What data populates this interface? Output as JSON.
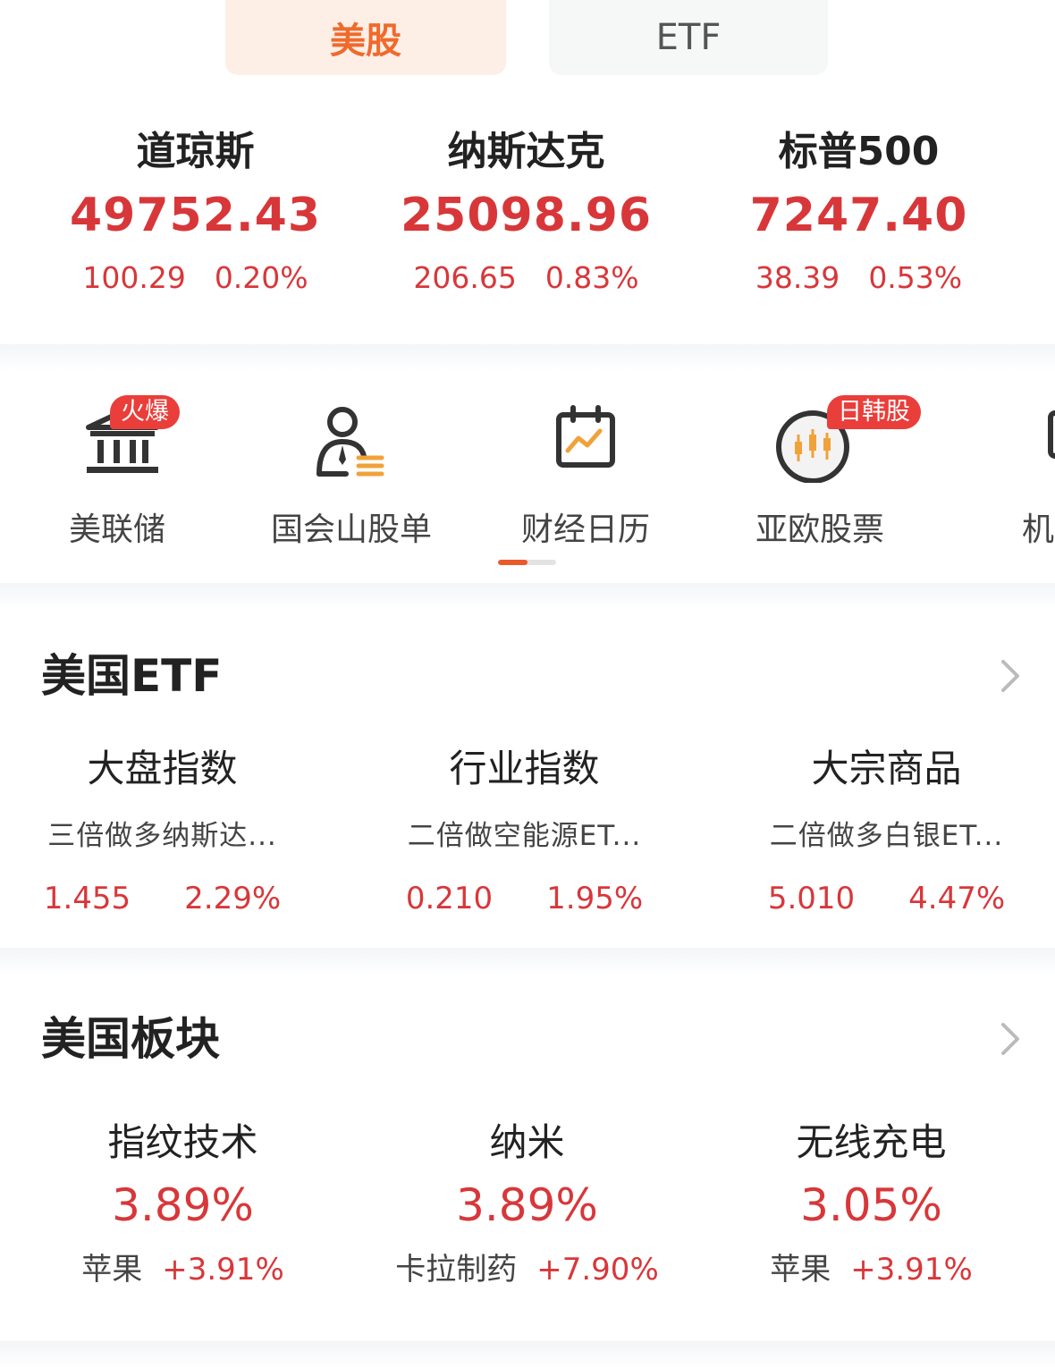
{
  "tabs": [
    {
      "label": "美股",
      "active": true
    },
    {
      "label": "ETF",
      "active": false
    }
  ],
  "indices": [
    {
      "name": "道琼斯",
      "price": "49752.43",
      "change": "100.29",
      "pct": "0.20%"
    },
    {
      "name": "纳斯达克",
      "price": "25098.96",
      "change": "206.65",
      "pct": "0.83%"
    },
    {
      "name": "标普500",
      "price": "7247.40",
      "change": "38.39",
      "pct": "0.53%"
    }
  ],
  "shortcuts": [
    {
      "label": "美联储",
      "icon": "bank-icon",
      "badge": "火爆"
    },
    {
      "label": "国会山股单",
      "icon": "congress-person-icon",
      "badge": ""
    },
    {
      "label": "财经日历",
      "icon": "calendar-chart-icon",
      "badge": ""
    },
    {
      "label": "亚欧股票",
      "icon": "globe-candlestick-icon",
      "badge": "日韩股"
    },
    {
      "label": "机构",
      "icon": "monitor-chart-icon",
      "badge": ""
    }
  ],
  "shortcuts_scroll_progress": 0.5,
  "etf_section": {
    "title": "美国ETF",
    "items": [
      {
        "category": "大盘指数",
        "name": "三倍做多纳斯达...",
        "price": "1.455",
        "pct": "2.29%"
      },
      {
        "category": "行业指数",
        "name": "二倍做空能源ET...",
        "price": "0.210",
        "pct": "1.95%"
      },
      {
        "category": "大宗商品",
        "name": "二倍做多白银ET...",
        "price": "5.010",
        "pct": "4.47%"
      }
    ]
  },
  "sector_section": {
    "title": "美国板块",
    "items": [
      {
        "name": "指纹技术",
        "pct": "3.89%",
        "leader": "苹果",
        "leader_pct": "+3.91%"
      },
      {
        "name": "纳米",
        "pct": "3.89%",
        "leader": "卡拉制药",
        "leader_pct": "+7.90%"
      },
      {
        "name": "无线充电",
        "pct": "3.05%",
        "leader": "苹果",
        "leader_pct": "+3.91%"
      }
    ]
  },
  "colors": {
    "up_red": "#d8373a",
    "accent_orange": "#ef6a2c",
    "badge_red": "#ea3e3a",
    "icon_orange": "#f0a23a"
  }
}
